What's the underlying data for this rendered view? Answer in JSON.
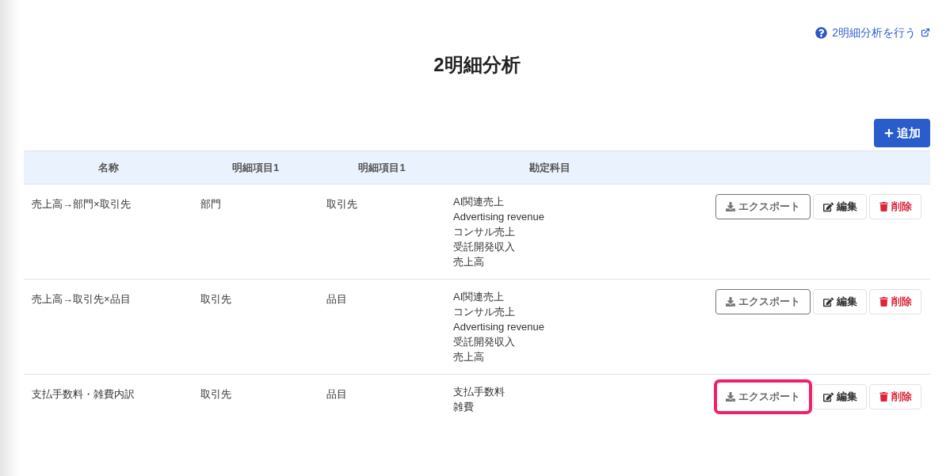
{
  "help_link": {
    "label": "2明細分析を行う"
  },
  "title": "2明細分析",
  "add_button": {
    "label": "追加"
  },
  "table": {
    "columns": [
      "名称",
      "明細項目1",
      "明細項目1",
      "勘定科目"
    ],
    "rows": [
      {
        "name": "売上高→部門×取引先",
        "item_1": "部門",
        "item_2": "取引先",
        "accounts": [
          "AI関連売上",
          "Advertising revenue",
          "コンサル売上",
          "受託開発収入",
          "売上高"
        ],
        "actions": [
          {
            "kind": "export",
            "label": "エクスポート",
            "highlighted": false
          },
          {
            "kind": "edit",
            "label": "編集"
          },
          {
            "kind": "delete",
            "label": "削除"
          }
        ]
      },
      {
        "name": "売上高→取引先×品目",
        "item_1": "取引先",
        "item_2": "品目",
        "accounts": [
          "AI関連売上",
          "コンサル売上",
          "Advertising revenue",
          "受託開発収入",
          "売上高"
        ],
        "actions": [
          {
            "kind": "export",
            "label": "エクスポート",
            "highlighted": false
          },
          {
            "kind": "edit",
            "label": "編集"
          },
          {
            "kind": "delete",
            "label": "削除"
          }
        ]
      },
      {
        "name": "支払手数料・雑費内訳",
        "item_1": "取引先",
        "item_2": "品目",
        "accounts": [
          "支払手数料",
          "雑費"
        ],
        "actions": [
          {
            "kind": "export",
            "label": "エクスポート",
            "highlighted": true
          },
          {
            "kind": "edit",
            "label": "編集"
          },
          {
            "kind": "delete",
            "label": "削除"
          }
        ]
      }
    ]
  }
}
